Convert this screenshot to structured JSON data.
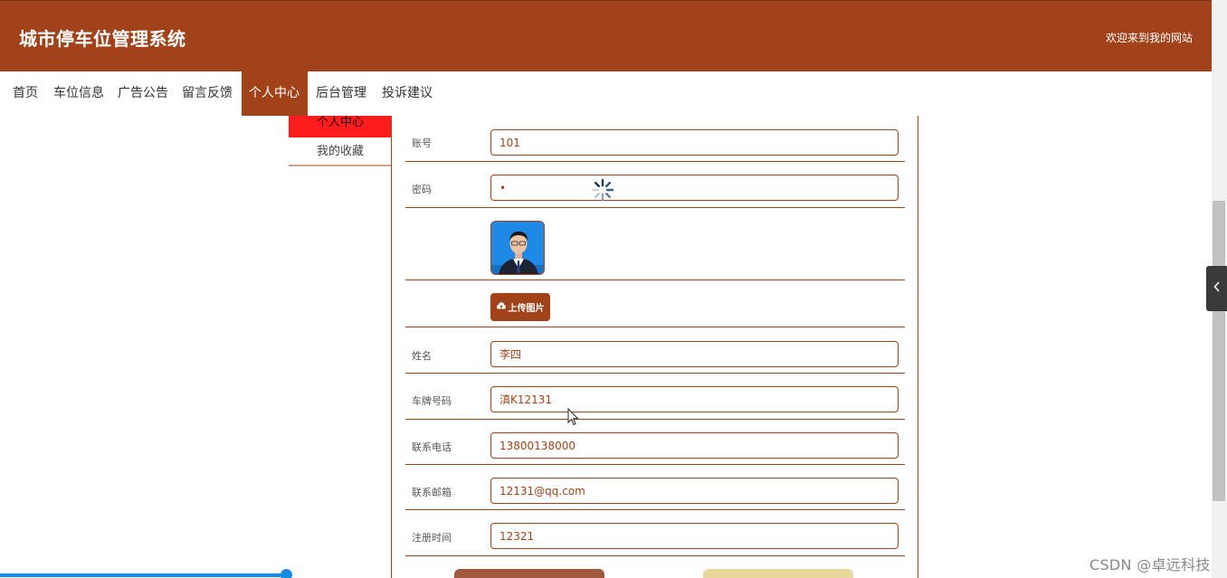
{
  "header": {
    "title": "城市停车位管理系统",
    "welcome": "欢迎来到我的网站"
  },
  "nav": [
    {
      "label": "首页"
    },
    {
      "label": "车位信息"
    },
    {
      "label": "广告公告"
    },
    {
      "label": "留言反馈"
    },
    {
      "label": "个人中心",
      "active": true
    },
    {
      "label": "后台管理"
    },
    {
      "label": "投诉建议"
    }
  ],
  "submenu": [
    {
      "label": "个人中心",
      "active": true
    },
    {
      "label": "我的收藏"
    }
  ],
  "form": {
    "account": {
      "label": "账号",
      "value": "101"
    },
    "password": {
      "label": "密码",
      "value": "•"
    },
    "upload_label": "上传图片",
    "name": {
      "label": "姓名",
      "value": "李四"
    },
    "plate": {
      "label": "车牌号码",
      "value": "滇K12131"
    },
    "phone": {
      "label": "联系电话",
      "value": "13800138000"
    },
    "email": {
      "label": "联系邮箱",
      "value": "12131@qq.com"
    },
    "register_time": {
      "label": "注册时间",
      "value": "12321"
    }
  },
  "watermark": "CSDN @卓远科技",
  "colors": {
    "brand": "#a1421a",
    "submenu_active": "#ff1d1d",
    "logout_button": "#e8d69a",
    "progress": "#1a8be0"
  }
}
